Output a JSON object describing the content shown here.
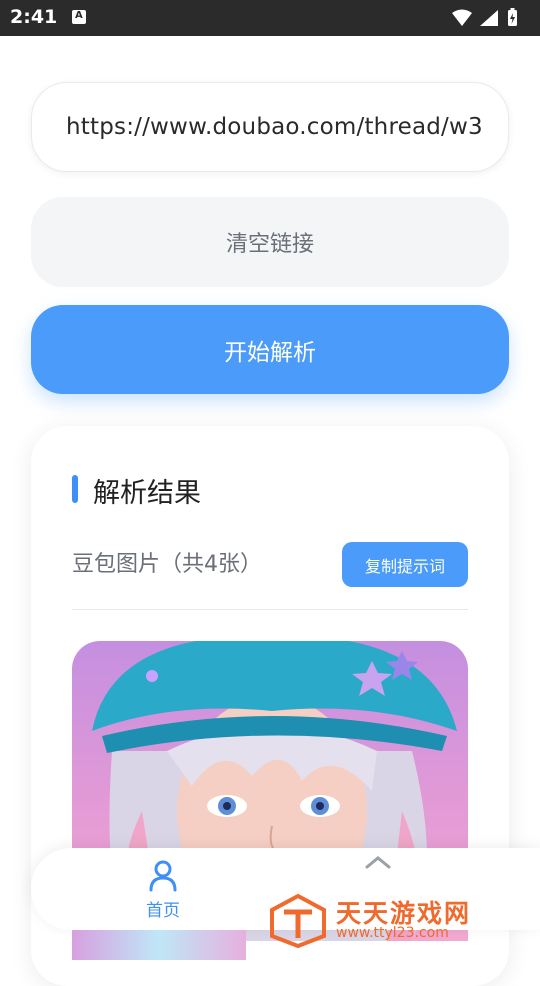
{
  "status_bar": {
    "time": "2:41"
  },
  "url_input": {
    "value": "https://www.doubao.com/thread/w3"
  },
  "buttons": {
    "clear_label": "清空链接",
    "parse_label": "开始解析"
  },
  "result": {
    "title": "解析结果",
    "image_count_text": "豆包图片（共4张）",
    "copy_prompt_label": "复制提示词"
  },
  "bottom_nav": {
    "home_label": "首页"
  },
  "watermark": {
    "name": "天天游戏网",
    "url": "www.ttyl23.com"
  },
  "colors": {
    "primary": "#4a9bfa",
    "clear_bg": "#f4f5f7",
    "watermark": "#ef6a2c"
  },
  "icons": {
    "status": [
      "notification-icon",
      "wifi-icon",
      "signal-icon",
      "battery-icon"
    ],
    "nav": [
      "home-person-icon",
      "chevron-up-icon"
    ],
    "watermark": "watermark-logo-icon"
  }
}
